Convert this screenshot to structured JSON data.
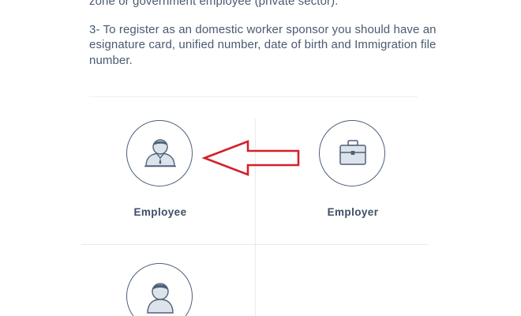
{
  "instructions": {
    "line_partial": "zone or government employee (private sector).",
    "item3": "3- To register as an domestic worker sponsor you should have an esignature card, unified number, date of birth and Immigration file number."
  },
  "options": [
    {
      "label": "Employee",
      "icon": "employee-icon"
    },
    {
      "label": "Employer",
      "icon": "briefcase-icon"
    },
    {
      "label": "",
      "icon": "person-icon"
    }
  ],
  "annotation": {
    "icon": "red-arrow-icon",
    "color": "#d4202a"
  },
  "colors": {
    "text": "#4a5a72",
    "label": "#3e4e65",
    "icon_outline": "#4e6079",
    "icon_fill": "#dde3ea"
  }
}
